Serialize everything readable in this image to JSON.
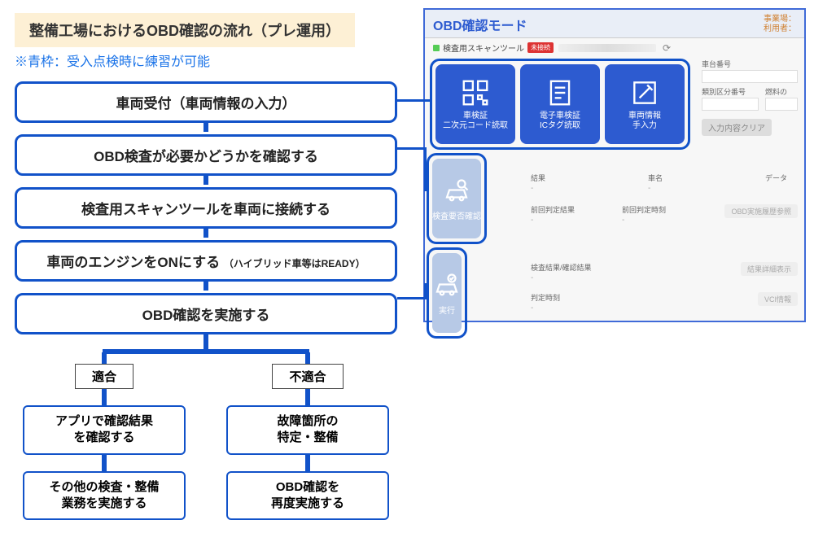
{
  "title": "整備工場におけるOBD確認の流れ（プレ運用）",
  "note": "※青枠：受入点検時に練習が可能",
  "flow": {
    "steps": [
      "車両受付（車両情報の入力）",
      "OBD検査が必要かどうかを確認する",
      "検査用スキャンツールを車両に接続する",
      "車両のエンジンをONにする",
      "OBD確認を実施する"
    ],
    "step4_sub": "（ハイブリッド車等はREADY）",
    "branch_labels": {
      "pass": "適合",
      "fail": "不適合"
    },
    "pass_steps": [
      "アプリで確認結果\nを確認する",
      "その他の検査・整備\n業務を実施する"
    ],
    "fail_steps": [
      "故障箇所の\n特定・整備",
      "OBD確認を\n再度実施する"
    ]
  },
  "screen": {
    "title": "OBD確認モード",
    "user_labels": {
      "office": "事業場：",
      "user": "利用者："
    },
    "tool_label": "検査用スキャンツール",
    "tool_badge": "未接続",
    "cards": {
      "qr": {
        "l1": "車検証",
        "l2": "二次元コード読取"
      },
      "ic": {
        "l1": "電子車検証",
        "l2": "ICタグ読取"
      },
      "man": {
        "l1": "車両情報",
        "l2": "手入力"
      },
      "check": "検査要否確認",
      "run": "実行"
    },
    "fields": {
      "chassis": "車台番号",
      "class": "類別区分番号",
      "fuel": "燃料の",
      "clear_btn": "入力内容クリア",
      "result": "結果",
      "carname": "車名",
      "data": "データ",
      "prev_result": "前回判定結果",
      "prev_time": "前回判定時刻",
      "obd_ref_btn": "OBD実施履歴参照",
      "final_result": "検査結果/確認結果",
      "show_btn": "結果詳細表示",
      "judge_time": "判定時刻",
      "vci_btn": "VCI情報"
    }
  }
}
